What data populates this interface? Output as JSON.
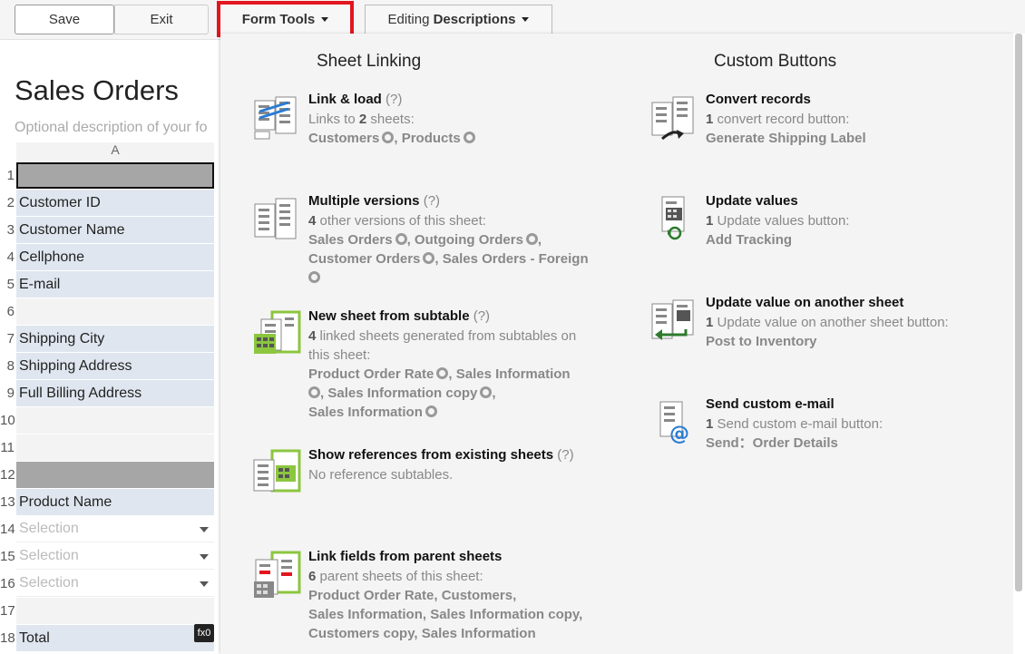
{
  "toolbar": {
    "save_label": "Save",
    "exit_label": "Exit",
    "form_tools_label": "Form Tools",
    "editing_prefix": "Editing",
    "editing_mode": "Descriptions"
  },
  "sheet": {
    "title": "Sales Orders",
    "description_placeholder": "Optional description of your fo",
    "column_header": "A",
    "fx_badge": "fx0",
    "rows": [
      {
        "num": "1",
        "label": "",
        "kind": "dark-sel"
      },
      {
        "num": "2",
        "label": "Customer ID",
        "kind": "lab"
      },
      {
        "num": "3",
        "label": "Customer Name",
        "kind": "lab"
      },
      {
        "num": "4",
        "label": "Cellphone",
        "kind": "lab"
      },
      {
        "num": "5",
        "label": "E-mail",
        "kind": "lab"
      },
      {
        "num": "6",
        "label": "",
        "kind": "blank"
      },
      {
        "num": "7",
        "label": "Shipping City",
        "kind": "lab"
      },
      {
        "num": "8",
        "label": "Shipping Address",
        "kind": "lab"
      },
      {
        "num": "9",
        "label": "Full Billing Address",
        "kind": "lab"
      },
      {
        "num": "10",
        "label": "",
        "kind": "blank"
      },
      {
        "num": "11",
        "label": "",
        "kind": "blank"
      },
      {
        "num": "12",
        "label": "",
        "kind": "dark"
      },
      {
        "num": "13",
        "label": "Product Name",
        "kind": "lab"
      },
      {
        "num": "14",
        "label": "Selection",
        "kind": "sel"
      },
      {
        "num": "15",
        "label": "Selection",
        "kind": "sel"
      },
      {
        "num": "16",
        "label": "Selection",
        "kind": "sel"
      },
      {
        "num": "17",
        "label": "",
        "kind": "blank"
      },
      {
        "num": "18",
        "label": "Total",
        "kind": "lab"
      }
    ]
  },
  "panel": {
    "sheet_linking_header": "Sheet Linking",
    "custom_buttons_header": "Custom Buttons",
    "link_load": {
      "title": "Link & load",
      "q": "(?)",
      "sub_pre": "Links to",
      "count": "2",
      "sub_post": "sheets:",
      "links": [
        "Customers",
        "Products"
      ]
    },
    "multiple_versions": {
      "title": "Multiple versions",
      "q": "(?)",
      "count": "4",
      "sub": "other versions of this sheet:",
      "links": [
        "Sales Orders",
        "Outgoing Orders",
        "Customer Orders",
        "Sales Orders - Foreign"
      ]
    },
    "new_sheet_subtable": {
      "title": "New sheet from subtable",
      "q": "(?)",
      "count": "4",
      "sub_line1": "linked sheets generated from subtables on",
      "sub_line2": "this sheet:",
      "links": [
        "Product Order Rate",
        "Sales Information",
        "Sales Information copy",
        "Sales Information"
      ]
    },
    "show_references": {
      "title": "Show references from existing sheets",
      "q": "(?)",
      "sub": "No reference subtables."
    },
    "parent_fields": {
      "title": "Link fields from parent sheets",
      "count": "6",
      "sub": "parent sheets of this sheet:",
      "links": [
        "Product Order Rate",
        "Customers",
        "Sales Information",
        "Sales Information copy",
        "Customers copy",
        "Sales Information"
      ]
    },
    "convert_records": {
      "title": "Convert records",
      "count": "1",
      "sub": "convert record button:",
      "link": "Generate Shipping Label"
    },
    "update_values": {
      "title": "Update values",
      "count": "1",
      "sub": "Update values button:",
      "link": "Add Tracking"
    },
    "update_other": {
      "title": "Update value on another sheet",
      "count": "1",
      "sub": "Update value on another sheet button:",
      "link": "Post to Inventory"
    },
    "send_email": {
      "title": "Send custom e-mail",
      "count": "1",
      "sub": "Send custom e-mail button:",
      "link": "Send：Order Details"
    }
  },
  "colors": {
    "highlight_border": "#e2161f",
    "label_bg": "#dfe6ef",
    "panel_bg": "#f4f4f4",
    "icon_green": "#8cc63f",
    "icon_blue": "#2a7bd3"
  }
}
